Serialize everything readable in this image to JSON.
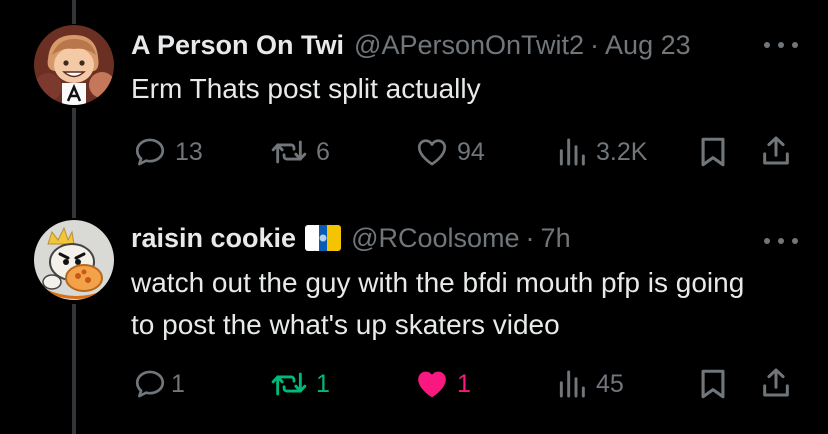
{
  "tweets": [
    {
      "display_name": "A Person On Twi",
      "handle": "@APersonOnTwit2",
      "separator": "·",
      "time": "Aug 23",
      "text": "Erm Thats post split actually",
      "replies": "13",
      "retweets": "6",
      "likes": "94",
      "views": "3.2K",
      "retweeted": false,
      "liked": false
    },
    {
      "display_name": "raisin cookie",
      "handle": "@RCoolsome",
      "separator": "·",
      "time": "7h",
      "text": "watch out the guy with the bfdi mouth pfp is going to post the what's up skaters video",
      "replies": "1",
      "retweets": "1",
      "likes": "1",
      "views": "45",
      "retweeted": true,
      "liked": true,
      "flag_emoji": "canary-islands-flag"
    }
  ],
  "colors": {
    "background": "#000000",
    "primary_text": "#e7e9ea",
    "secondary_text": "#71767b",
    "retweet_active": "#00ba7c",
    "like_active": "#f91880"
  },
  "icons": [
    "reply-icon",
    "retweet-icon",
    "like-icon",
    "views-icon",
    "bookmark-icon",
    "share-icon",
    "more-icon"
  ]
}
